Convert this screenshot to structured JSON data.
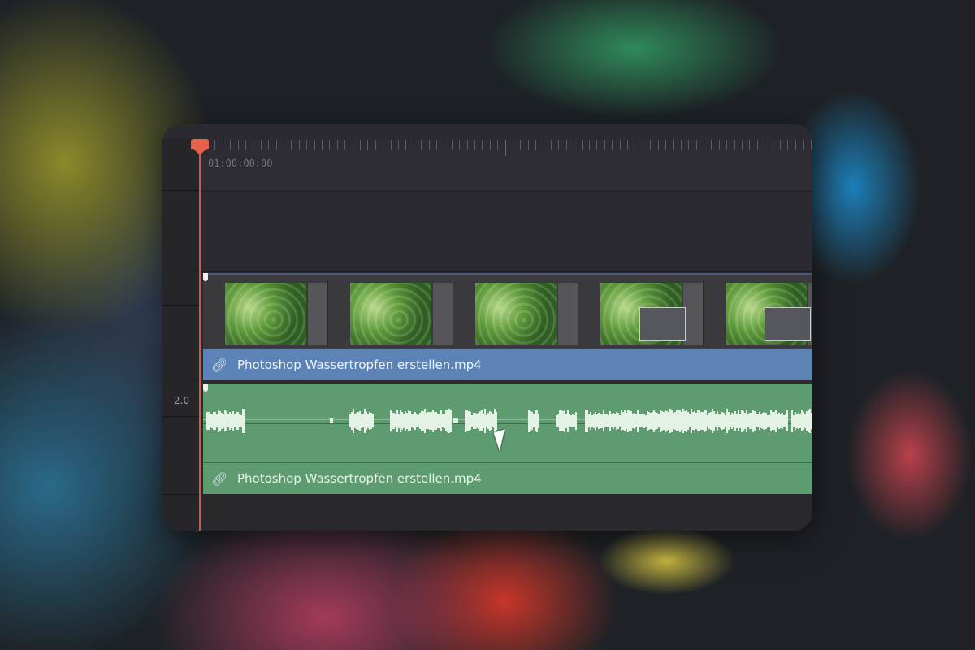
{
  "timeline": {
    "timecode": "01:00:00:00",
    "video_track": {
      "clip_name": "Photoshop Wassertropfen erstellen.mp4",
      "color": "#5b83b5",
      "link_icon": "link-icon"
    },
    "audio_track": {
      "clip_name": "Photoshop Wassertropfen erstellen.mp4",
      "volume_label": "2.0",
      "color": "#5e9b70",
      "link_icon": "link-icon"
    },
    "playhead_color": "#e0533f"
  }
}
